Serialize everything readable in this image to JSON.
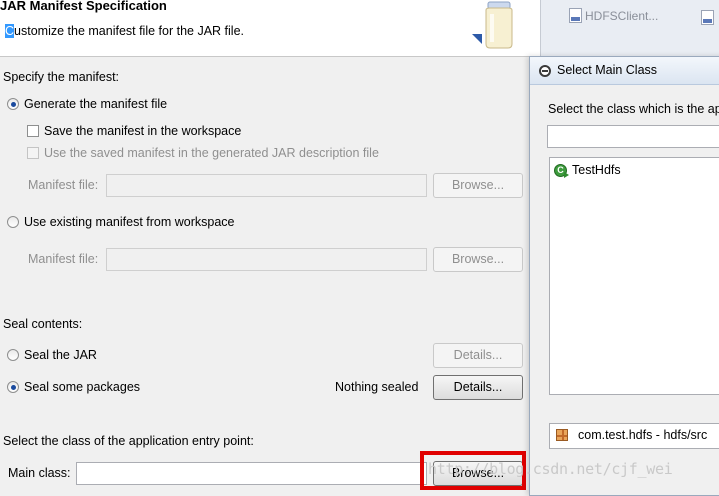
{
  "header": {
    "title": "JAR Manifest Specification",
    "description_first": "C",
    "description_rest": "ustomize the manifest file for the JAR file."
  },
  "editor_tab": {
    "label": "HDFSClient...",
    "icon": "class-file-icon"
  },
  "manifest": {
    "section_label": "Specify the manifest:",
    "generate_label": "Generate the manifest file",
    "generate_selected": true,
    "save_label": "Save the manifest in the workspace",
    "save_checked": false,
    "use_saved_label": "Use the saved manifest in the generated JAR description file",
    "manifest_file_label": "Manifest file:",
    "browse_label": "Browse...",
    "use_existing_label": "Use existing manifest from workspace",
    "manifest_file_label_2": "Manifest file:",
    "browse_label_2": "Browse..."
  },
  "seal": {
    "section_label": "Seal contents:",
    "seal_jar_label": "Seal the JAR",
    "details_label": "Details...",
    "seal_some_label": "Seal some packages",
    "seal_some_selected": true,
    "status": "Nothing sealed",
    "details_label_2": "Details..."
  },
  "entry_point": {
    "section_label": "Select the class of the application entry point:",
    "main_class_label": "Main class:",
    "main_class_value": "",
    "browse_label": "Browse..."
  },
  "dialog": {
    "title": "Select Main Class",
    "prompt": "Select the class which is the ap",
    "search_value": "",
    "items": [
      {
        "label": "TestHdfs",
        "icon": "runnable-class-icon"
      }
    ],
    "package": {
      "label": "com.test.hdfs - hdfs/src",
      "icon": "package-icon"
    }
  },
  "watermark": "http://blog.csdn.net/cjf_wei",
  "colors": {
    "highlight": "#e00000",
    "selection": "#3399ff",
    "dialog_title_bg": "#dbe5f1"
  }
}
